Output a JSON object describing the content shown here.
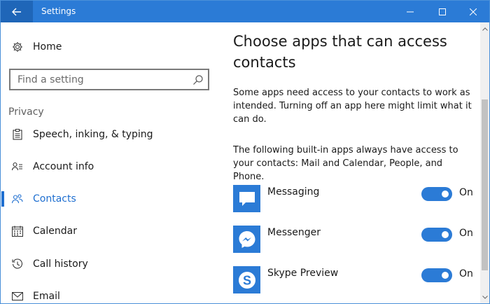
{
  "window": {
    "title": "Settings"
  },
  "sidebar": {
    "home_label": "Home",
    "search_placeholder": "Find a setting",
    "section_heading": "Privacy",
    "items": [
      {
        "label": "Speech, inking, & typing",
        "icon": "clipboard-icon"
      },
      {
        "label": "Account info",
        "icon": "account-info-icon"
      },
      {
        "label": "Contacts",
        "icon": "contacts-icon",
        "selected": true
      },
      {
        "label": "Calendar",
        "icon": "calendar-icon"
      },
      {
        "label": "Call history",
        "icon": "history-icon"
      },
      {
        "label": "Email",
        "icon": "email-icon"
      }
    ]
  },
  "main": {
    "title": "Choose apps that can access contacts",
    "description": "Some apps need access to your contacts to work as intended. Turning off an app here might limit what it can do.",
    "builtin_note": "The following built-in apps always have access to your contacts: Mail and Calendar, People, and Phone.",
    "apps": [
      {
        "name": "Messaging",
        "icon": "messaging-icon",
        "state": "On",
        "enabled": true
      },
      {
        "name": "Messenger",
        "icon": "messenger-icon",
        "state": "On",
        "enabled": true
      },
      {
        "name": "Skype Preview",
        "icon": "skype-icon",
        "state": "On",
        "enabled": true
      }
    ]
  },
  "colors": {
    "accent": "#2b7bd6",
    "titlebar": "#2b7bd6",
    "selected_text": "#1f6fd0"
  }
}
